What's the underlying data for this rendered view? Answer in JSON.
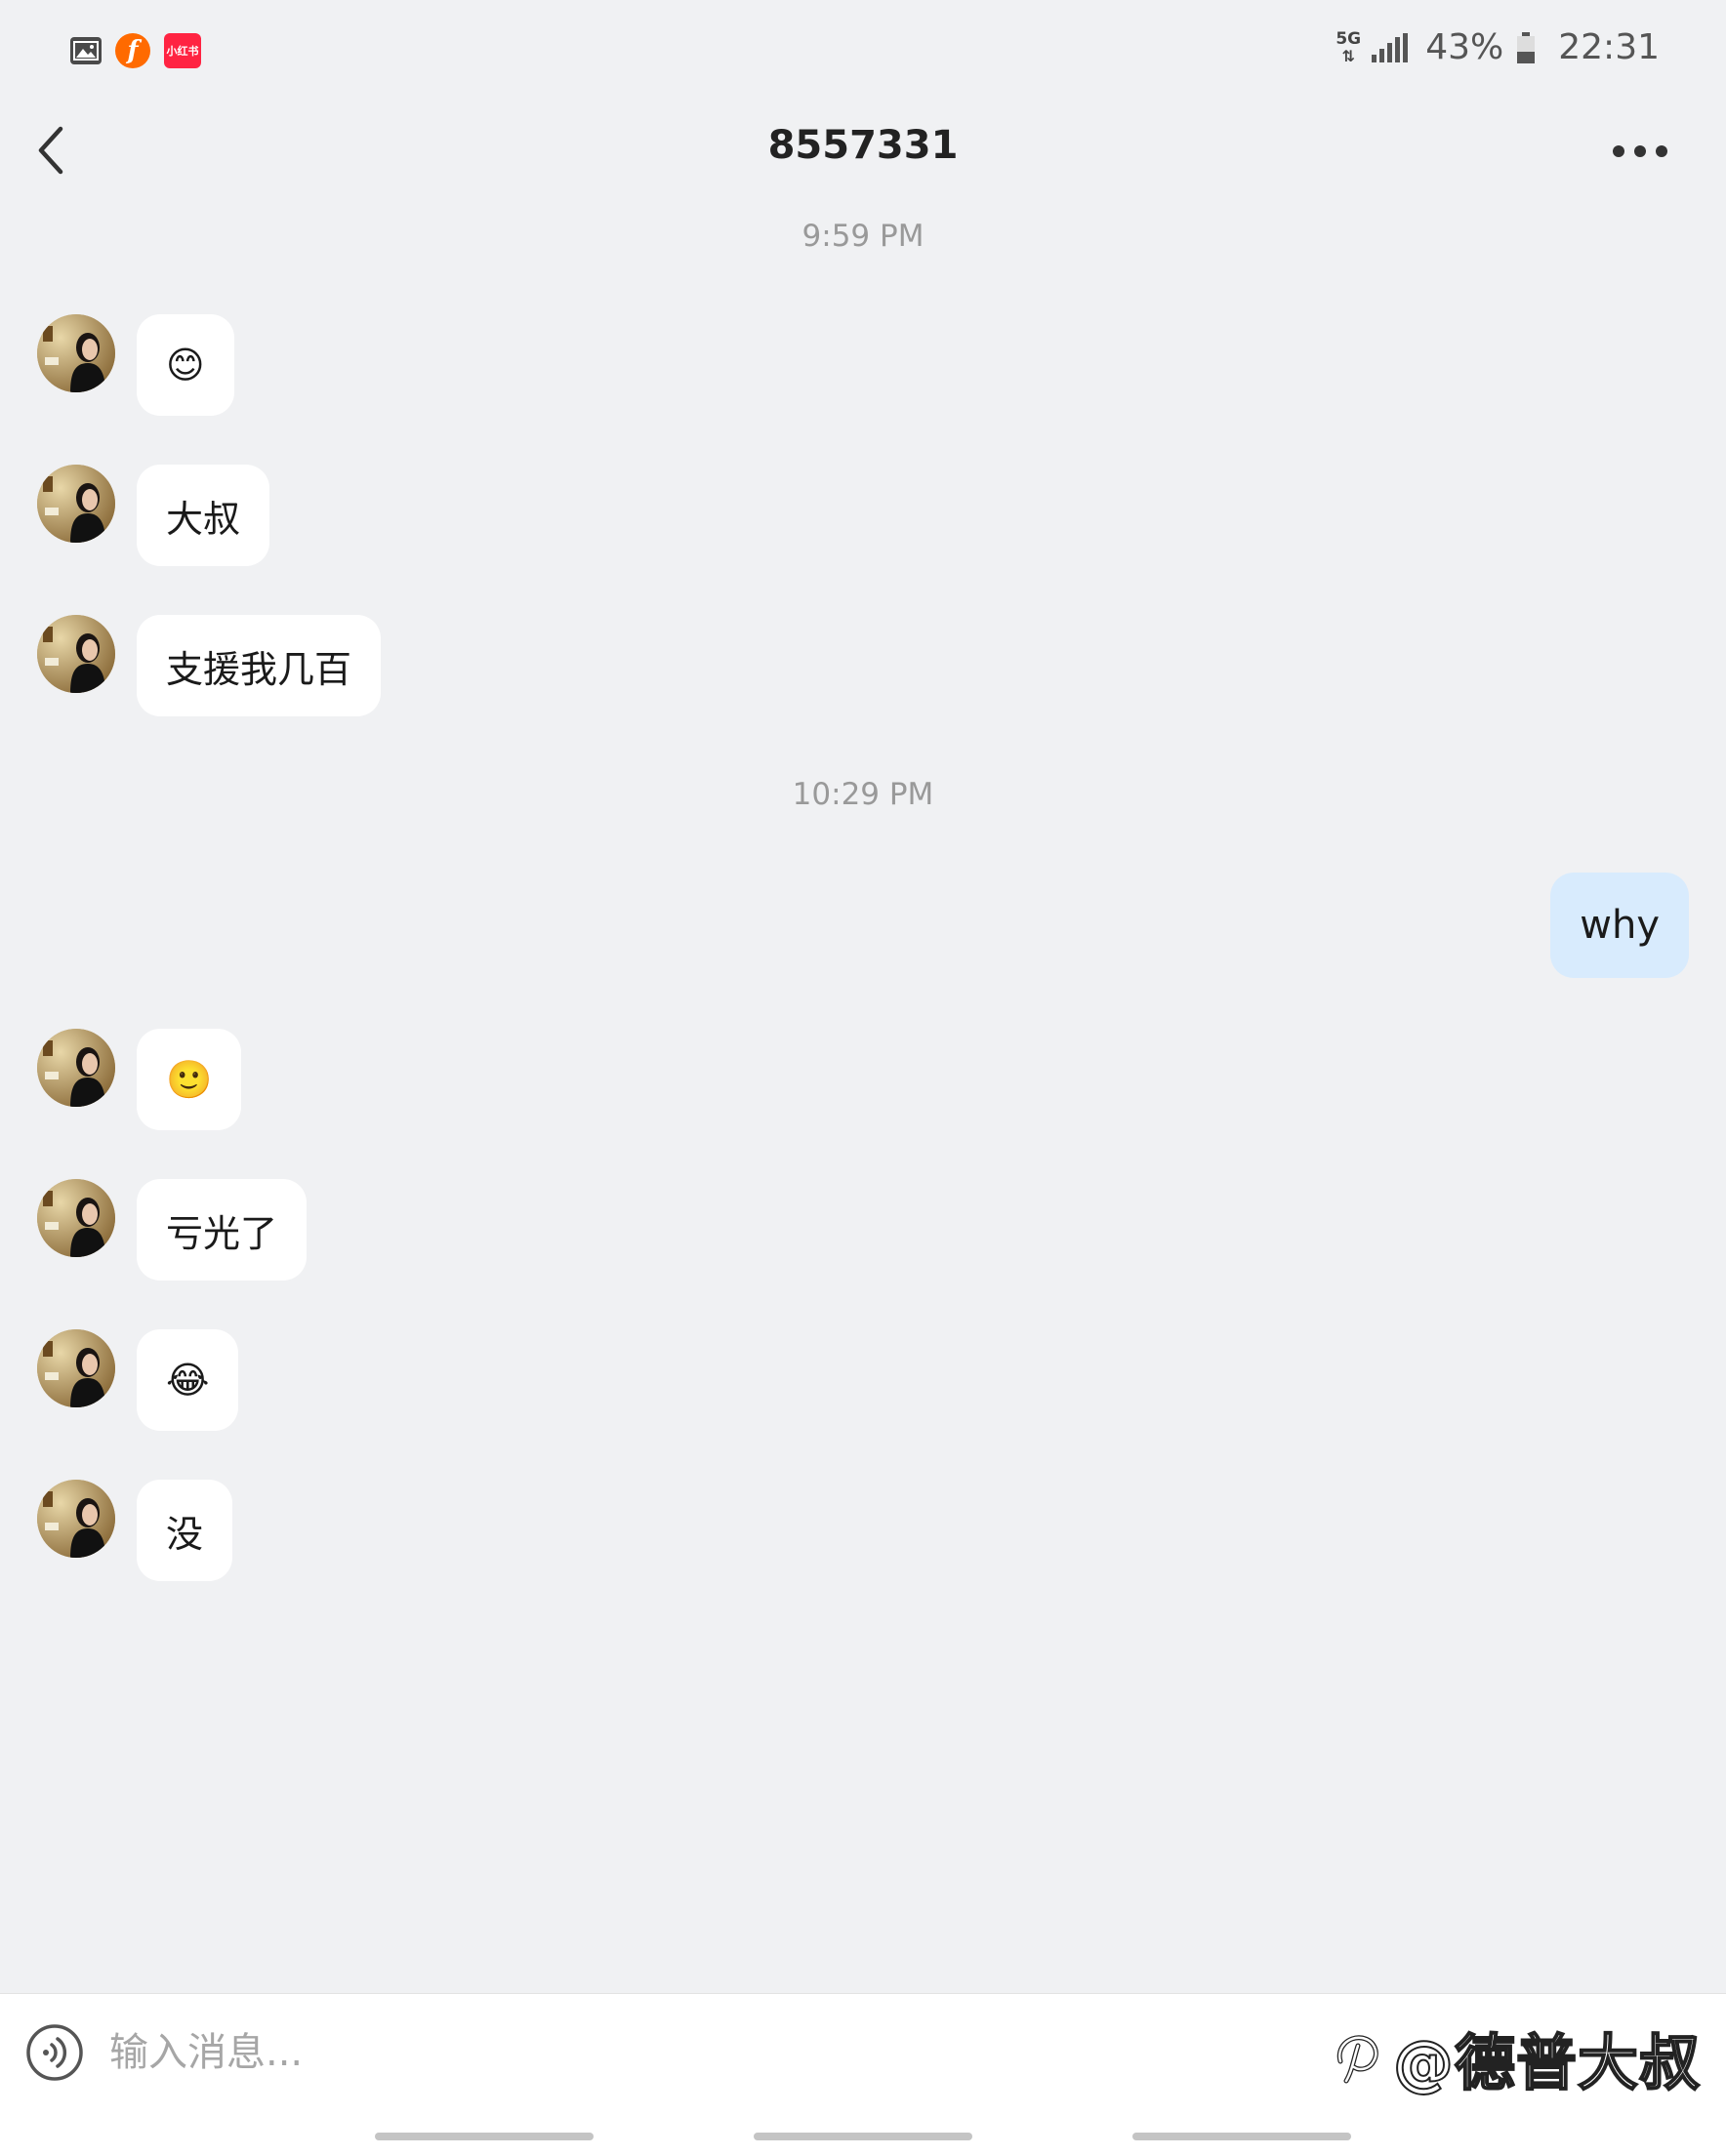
{
  "status_bar": {
    "app_icons": [
      "gallery-icon",
      "toutiao-icon",
      "xiaohongshu-icon"
    ],
    "toutiao_letter": "f",
    "xhs_label": "小红书",
    "network": "5G",
    "battery_percent": "43%",
    "battery_level": 0.43,
    "time": "22:31"
  },
  "header": {
    "title": "8557331"
  },
  "messages": {
    "timestamp_1": "9:59 PM",
    "timestamp_2": "10:29 PM",
    "m1_emoji": "😊",
    "m2": "大叔",
    "m3": "支援我几百",
    "m4_out": "why",
    "m5_emoji": "🙂",
    "m6": "亏光了",
    "m7_emoji": "😂",
    "m8": "没"
  },
  "input": {
    "placeholder": "输入消息..."
  },
  "watermark": {
    "text": "@德普大叔"
  },
  "colors": {
    "background": "#f0f1f3",
    "incoming_bubble": "#ffffff",
    "outgoing_bubble": "#d8ebfd",
    "timestamp": "#999999"
  }
}
